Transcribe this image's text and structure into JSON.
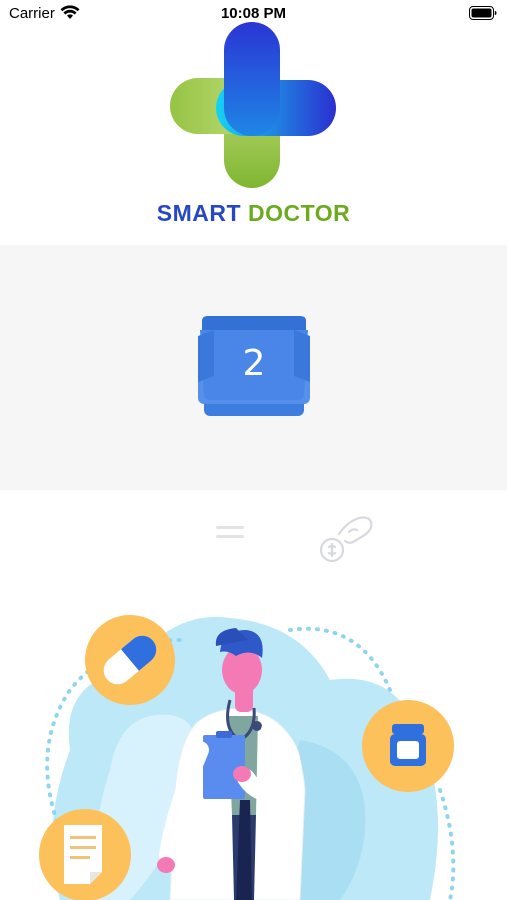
{
  "status_bar": {
    "carrier": "Carrier",
    "time": "10:08 PM",
    "icons": [
      "wifi-icon",
      "battery-icon"
    ]
  },
  "brand": {
    "name_part1": "SMART",
    "name_part2": "DOCTOR",
    "colors": {
      "smart": "#2747c4",
      "doctor": "#6eaa1e"
    },
    "logo_icon": "medical-cross-logo"
  },
  "banner": {
    "calendar_day": "2",
    "background": "#f6f6f6",
    "icon": "calendar-icon"
  },
  "bottom_nav": {
    "icons": [
      "menu-icon",
      "payment-icon"
    ]
  },
  "illustration": {
    "icons": [
      "doctor-illustration",
      "pill-icon",
      "medicine-jar-icon",
      "document-icon"
    ],
    "accent": "#fcc15a"
  }
}
